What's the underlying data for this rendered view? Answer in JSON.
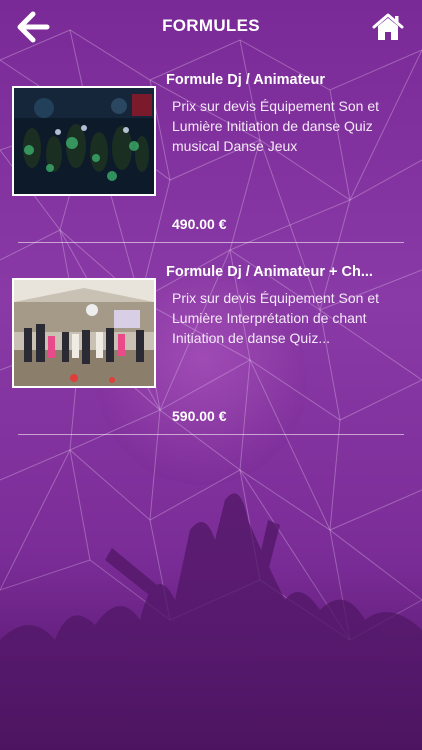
{
  "header": {
    "title": "FORMULES",
    "back_icon": "arrow-left-icon",
    "home_icon": "home-icon"
  },
  "colors": {
    "background": "#7a2a96",
    "text": "#ffffff"
  },
  "formulas": [
    {
      "name": "Formule Dj / Animateur",
      "description": "Prix sur devis Équipement Son et Lumière Initiation de danse Quiz musical Danse Jeux",
      "price": "490.00 €"
    },
    {
      "name": "Formule Dj / Animateur + Ch...",
      "description": "Prix sur devis Équipement Son et Lumière Interprétation de chant Initiation de danse Quiz...",
      "price": "590.00 €"
    }
  ]
}
